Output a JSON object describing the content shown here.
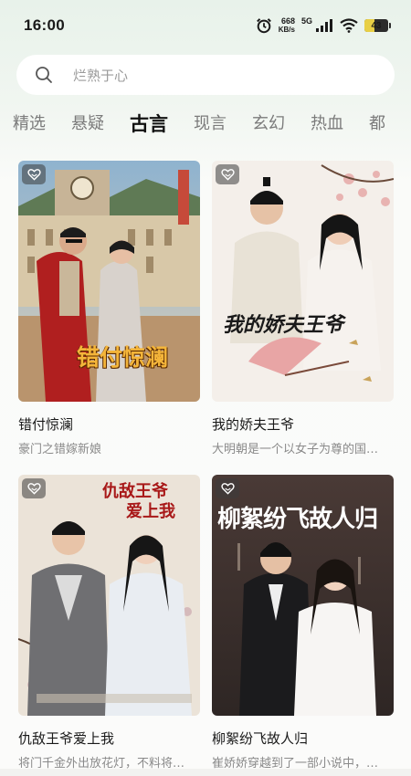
{
  "status_bar": {
    "time": "16:00",
    "net_speed_value": "668",
    "net_speed_unit": "KB/s",
    "network_gen": "5G",
    "battery_level": "43",
    "battery_fraction": 0.43,
    "icons": [
      "alarm-icon",
      "signal-icon",
      "wifi-icon",
      "battery-icon"
    ]
  },
  "search": {
    "placeholder": "烂熟于心",
    "icon": "search-icon"
  },
  "tabs": [
    {
      "label": "精选",
      "active": false
    },
    {
      "label": "悬疑",
      "active": false
    },
    {
      "label": "古言",
      "active": true
    },
    {
      "label": "现言",
      "active": false
    },
    {
      "label": "玄幻",
      "active": false
    },
    {
      "label": "热血",
      "active": false
    },
    {
      "label": "都",
      "active": false
    }
  ],
  "books": [
    {
      "title": "错付惊澜",
      "description": "豪门之错嫁新娘",
      "cover_text": "错付惊澜",
      "cover_text_color": "#f4b53a"
    },
    {
      "title": "我的娇夫王爷",
      "description": "大明朝是一个以女子为尊的国…",
      "cover_text": "我的娇夫王爷",
      "cover_text_color": "#1a1a1a"
    },
    {
      "title": "仇敌王爷爱上我",
      "description": "将门千金外出放花灯，不料将…",
      "cover_text_line1": "仇敌王爷",
      "cover_text_line2": "爱上我",
      "cover_text_color": "#a81818"
    },
    {
      "title": "柳絮纷飞故人归",
      "description": "崔娇娇穿越到了一部小说中，…",
      "cover_text": "柳絮纷飞故人归",
      "cover_text_color": "#ffffff"
    }
  ]
}
